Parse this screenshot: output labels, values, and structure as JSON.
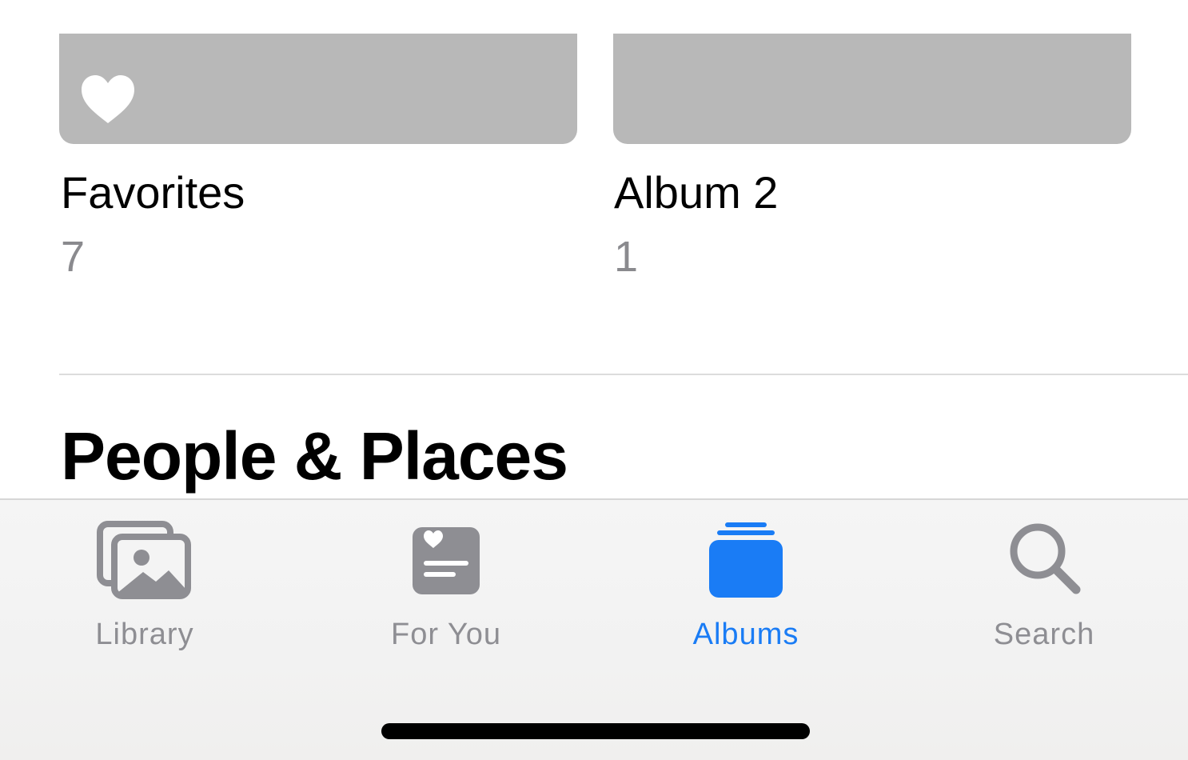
{
  "albums": [
    {
      "title": "Favorites",
      "count": "7",
      "icon": "heart-icon"
    },
    {
      "title": "Album 2",
      "count": "1"
    }
  ],
  "section": {
    "heading": "People & Places"
  },
  "tabbar": {
    "active_tab": "Albums",
    "accent_color": "#1a7cf5",
    "inactive_color": "#8e8e93",
    "tabs": [
      {
        "label": "Library",
        "icon": "library-photos-icon"
      },
      {
        "label": "For You",
        "icon": "for-you-icon"
      },
      {
        "label": "Albums",
        "icon": "albums-stack-icon"
      },
      {
        "label": "Search",
        "icon": "search-icon"
      }
    ]
  }
}
